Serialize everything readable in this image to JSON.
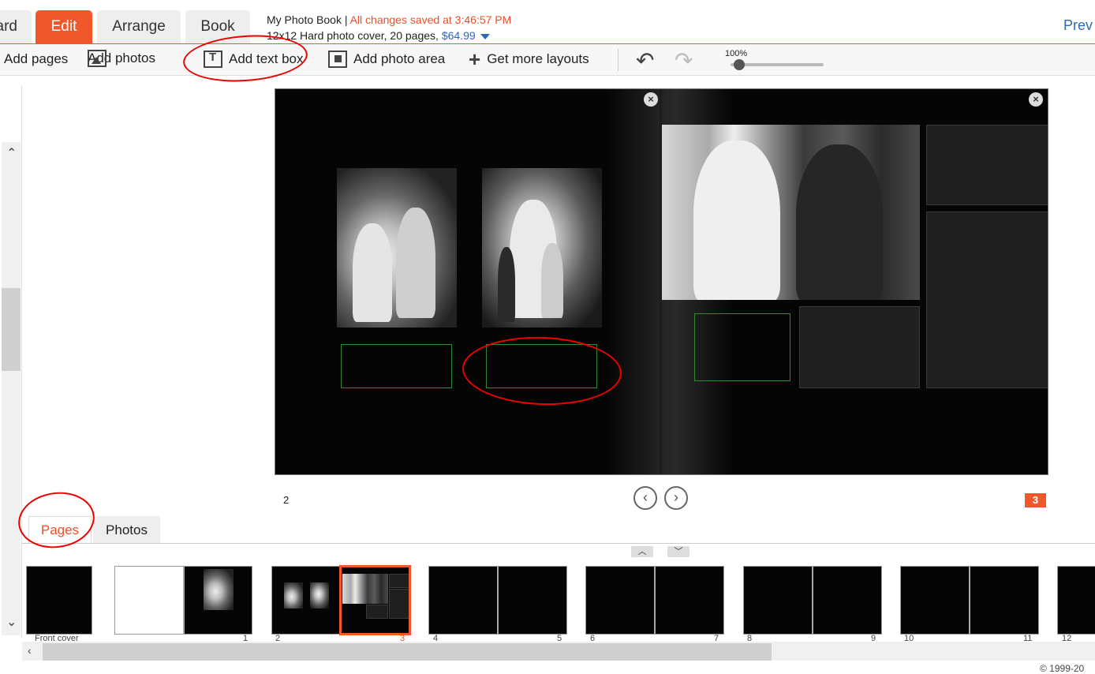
{
  "tabs": [
    {
      "label": "ard"
    },
    {
      "label": "Edit"
    },
    {
      "label": "Arrange"
    },
    {
      "label": "Book"
    }
  ],
  "book": {
    "title": "My Photo Book",
    "separator": " | ",
    "saved_status": "All changes saved at 3:46:57 PM",
    "details": "12x12 Hard photo cover, 20 pages, ",
    "price": "$64.99"
  },
  "preview_label": "Prev",
  "toolbar": {
    "add_pages": "Add pages",
    "add_photos": "Add photos",
    "add_text_box": "Add text box",
    "add_photo_area": "Add photo area",
    "get_more_layouts": "Get more layouts",
    "zoom_label": "100%",
    "zoom_fraction": 0.05
  },
  "spread": {
    "left_page_number": "2",
    "right_page_number": "3"
  },
  "bottom_tabs": {
    "pages": "Pages",
    "photos": "Photos"
  },
  "thumbnails": [
    {
      "label": "Front cover"
    },
    {
      "label_left": "",
      "label_right": "1"
    },
    {
      "label_left": "2",
      "label_right": "3"
    },
    {
      "label_left": "4",
      "label_right": "5"
    },
    {
      "label_left": "6",
      "label_right": "7"
    },
    {
      "label_left": "8",
      "label_right": "9"
    },
    {
      "label_left": "10",
      "label_right": "11"
    },
    {
      "label_left": "12",
      "label_right": ""
    }
  ],
  "copyright": "© 1999-20",
  "colors": {
    "accent": "#f0572a",
    "link": "#2a6ab3",
    "textbox_border": "#2f8a2f",
    "annotation": "#e00000"
  }
}
